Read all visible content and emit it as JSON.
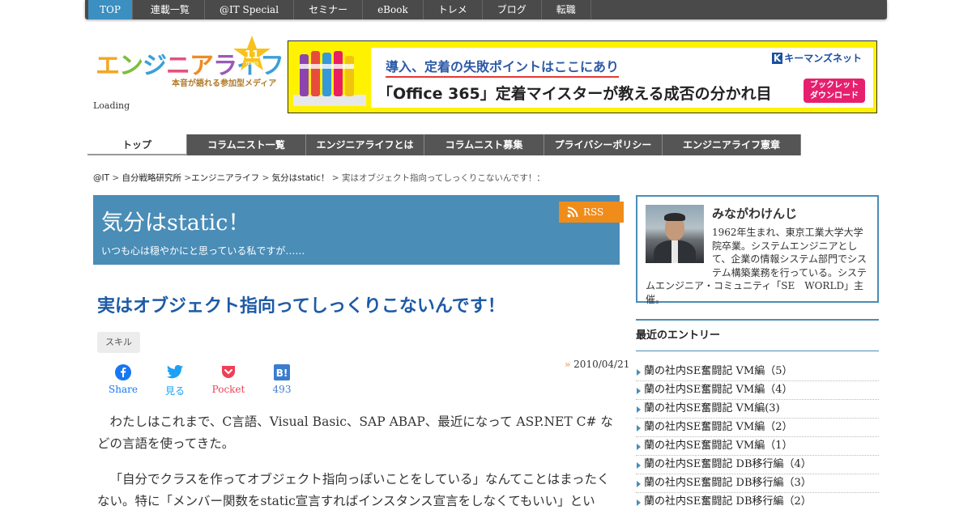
{
  "global_nav": [
    {
      "label": "TOP",
      "active": true
    },
    {
      "label": "連載一覧"
    },
    {
      "label": "@IT Special"
    },
    {
      "label": "セミナー"
    },
    {
      "label": "eBook"
    },
    {
      "label": "トレメ"
    },
    {
      "label": "ブログ"
    },
    {
      "label": "転職"
    }
  ],
  "logo": {
    "chars": [
      "エ",
      "ン",
      "ジ",
      "ニ",
      "ア",
      "ラ",
      "イフ"
    ],
    "subtitle": "本音が語れる参加型メディア",
    "anniversary": "11",
    "anniversary_unit": "YEARS"
  },
  "loading_text": "Loading",
  "banner": {
    "line1": "導入、定着の失敗ポイントはここにあり",
    "line2": "「Office 365」定着マイスターが教える成否の分かれ目",
    "brand_mark": "K",
    "brand": "キーマンズネット",
    "button": "ブックレット\nダウンロード"
  },
  "sub_nav": [
    {
      "label": "トップ",
      "active": true
    },
    {
      "label": "コラムニスト一覧"
    },
    {
      "label": "エンジニアライフとは"
    },
    {
      "label": "コラムニスト募集"
    },
    {
      "label": "プライバシーポリシー"
    },
    {
      "label": "エンジニアライフ憲章"
    }
  ],
  "breadcrumb": {
    "items": [
      "@IT",
      "自分戦略研究所",
      "エンジニアライフ",
      "気分はstatic！"
    ],
    "current": "実はオブジェクト指向ってしっくりこないんです！："
  },
  "blog": {
    "title": "気分はstatic！",
    "description": "いつも心は穏やかにと思っている私ですが……",
    "rss_label": "RSS"
  },
  "article": {
    "title": "実はオブジェクト指向ってしっくりこないんです！",
    "tag": "スキル",
    "date": "2010/04/21",
    "date_marker": "»",
    "share": [
      {
        "label": "Share",
        "color": "#1877f2",
        "icon": "facebook-icon"
      },
      {
        "label": "見る",
        "color": "#1da1f2",
        "icon": "twitter-icon"
      },
      {
        "label": "Pocket",
        "color": "#ef4056",
        "icon": "pocket-icon"
      },
      {
        "label": "493",
        "color": "#3a7dd0",
        "icon": "hatena-bookmark-icon"
      }
    ],
    "paragraph1": "わたしはこれまで、C言語、Visual Basic、SAP ABAP、最近になって ASP.NET C# などの言語を使ってきた。",
    "paragraph2": "「自分でクラスを作ってオブジェクト指向っぽいことをしている」なんてことはまったくない。特に「メンバー関数をstatic宣言すればインスタンス宣言をしなくてもいい」とい"
  },
  "profile": {
    "name": "みながわけんじ",
    "bio": "1962年生まれ、東京工業大学大学院卒業。システムエンジニアとして、企業の情報システム部門でシステム構築業務を行っている。システムエンジニア・コミュニティ「SE　WORLD」主催。"
  },
  "recent": {
    "heading": "最近のエントリー",
    "items": [
      "蘭の社内SE奮闘記 VM編（5）",
      "蘭の社内SE奮闘記 VM編（4）",
      "蘭の社内SE奮闘記 VM編(3)",
      "蘭の社内SE奮闘記 VM編（2）",
      "蘭の社内SE奮闘記 VM編（1）",
      "蘭の社内SE奮闘記 DB移行編（4）",
      "蘭の社内SE奮闘記 DB移行編（3）",
      "蘭の社内SE奮闘記 DB移行編（2）"
    ]
  },
  "colors": {
    "accent_blue": "#4a8db7",
    "title_blue": "#1d5aa6",
    "rss_orange": "#f08c1a",
    "nav_dark": "#4a4a4a",
    "banner_yellow": "#fff200"
  }
}
